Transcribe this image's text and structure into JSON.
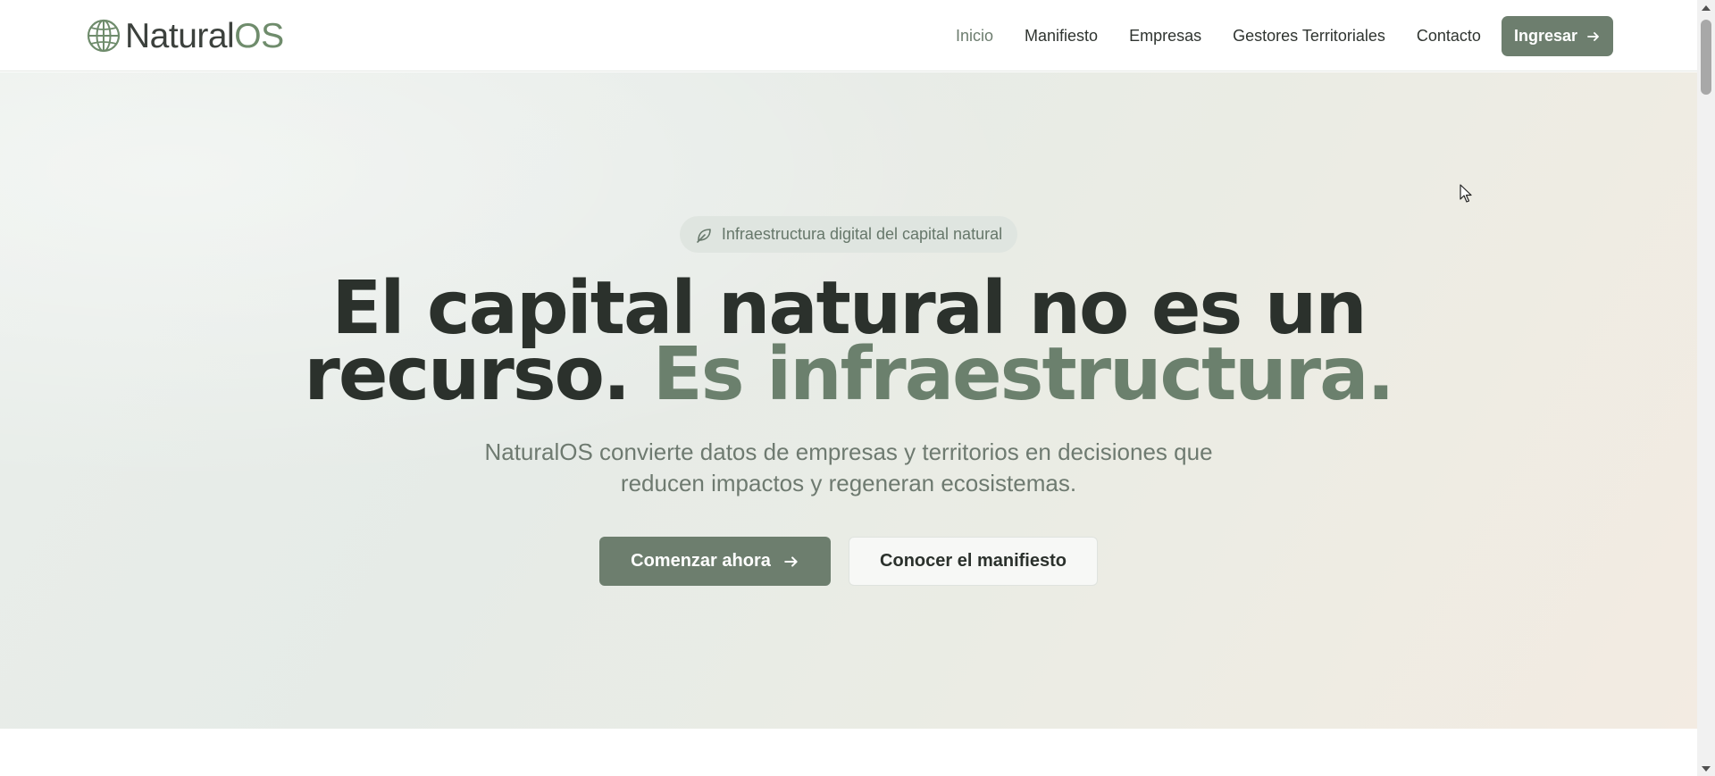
{
  "brand": {
    "name_part1": "Natural",
    "name_part2": "OS",
    "icon": "globe-icon",
    "accent_color": "#6f8c6c"
  },
  "nav": {
    "items": [
      {
        "label": "Inicio",
        "active": true
      },
      {
        "label": "Manifiesto",
        "active": false
      },
      {
        "label": "Empresas",
        "active": false
      },
      {
        "label": "Gestores Territoriales",
        "active": false
      },
      {
        "label": "Contacto",
        "active": false
      }
    ],
    "login_label": "Ingresar",
    "login_icon": "arrow-right-icon"
  },
  "hero": {
    "badge": {
      "icon": "leaf-icon",
      "text": "Infraestructura digital del capital natural"
    },
    "headline_line1": "El capital natural no es un",
    "headline_line2_dark": "recurso.",
    "headline_line2_accent": "Es infraestructura.",
    "subtitle_line1": "NaturalOS convierte datos de empresas y territorios en decisiones que",
    "subtitle_line2": "reducen impactos y regeneran ecosistemas.",
    "primary_cta": "Comenzar ahora",
    "secondary_cta": "Conocer el manifiesto"
  },
  "colors": {
    "button_bg": "#6d7e6e",
    "headline": "#2b312c",
    "headline_accent": "#6b806d"
  }
}
